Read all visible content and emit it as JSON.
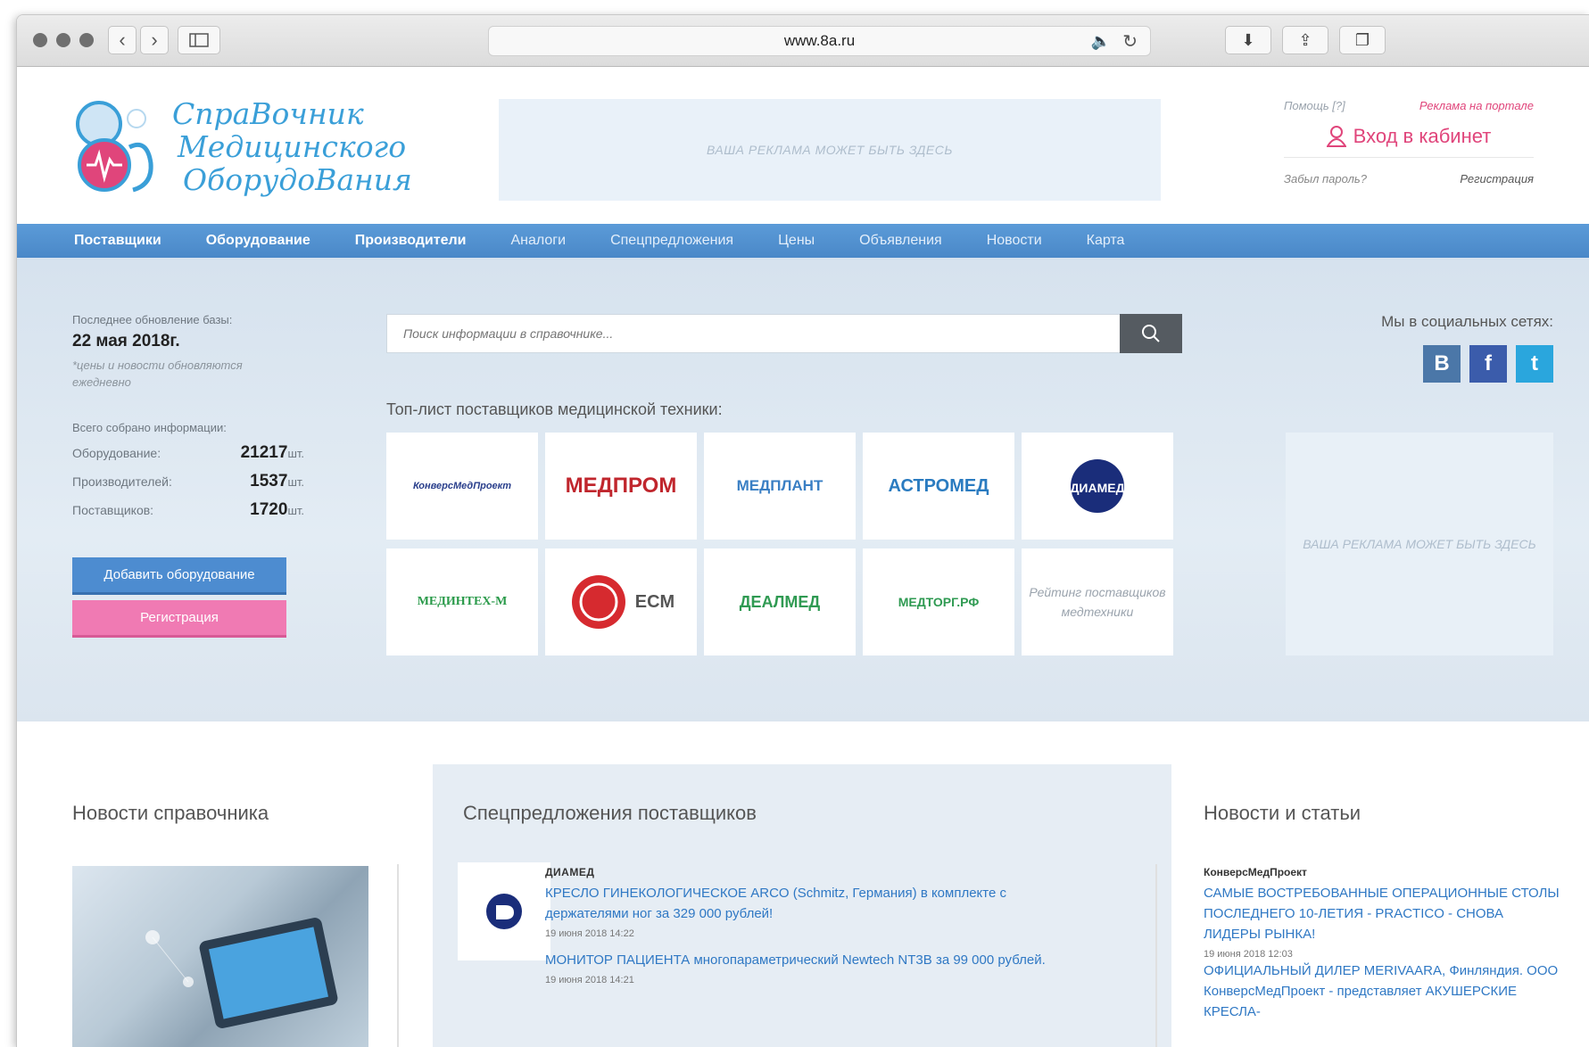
{
  "browser": {
    "url": "www.8a.ru"
  },
  "header": {
    "logo_lines": [
      "СпраВочник",
      "Медицинского",
      "ОборудоВания"
    ],
    "ad_text": "ВАША РЕКЛАМА МОЖЕТ БЫТЬ ЗДЕСЬ",
    "help": "Помощь [?]",
    "advertise": "Реклама на портале",
    "login": "Вход в кабинет",
    "forgot": "Забыл пароль?",
    "register": "Регистрация"
  },
  "nav": [
    "Поставщики",
    "Оборудование",
    "Производители",
    "Аналоги",
    "Спецпредложения",
    "Цены",
    "Объявления",
    "Новости",
    "Карта"
  ],
  "sidebar": {
    "update_label": "Последнее обновление базы:",
    "update_date": "22 мая 2018г.",
    "update_note": "*цены и новости обновляются ежедневно",
    "total_label": "Всего собрано информации:",
    "stats": [
      {
        "label": "Оборудование:",
        "value": "21217",
        "unit": "шт."
      },
      {
        "label": "Производителей:",
        "value": "1537",
        "unit": "шт."
      },
      {
        "label": "Поставщиков:",
        "value": "1720",
        "unit": "шт."
      }
    ],
    "add_button": "Добавить оборудование",
    "register_button": "Регистрация"
  },
  "search": {
    "placeholder": "Поиск информации в справочнике..."
  },
  "top_list": {
    "title": "Топ-лист поставщиков медицинской техники:",
    "suppliers": [
      {
        "name": "КонверсМедПроект",
        "color": "#2a3f8c"
      },
      {
        "name": "МЕДПРОМ",
        "color": "#c0262d"
      },
      {
        "name": "МЕДПЛАНТ",
        "color": "#3a7fc4"
      },
      {
        "name": "АСТРОМЕД",
        "color": "#2a7bc0"
      },
      {
        "name": "ДИАМЕД",
        "color": "#1a2d7a"
      },
      {
        "name": "МЕДИНТЕХ-М",
        "color": "#2a9a4a"
      },
      {
        "name": "ECM",
        "color": "#555555"
      },
      {
        "name": "ДЕАЛМЕД",
        "color": "#2f9a52"
      },
      {
        "name": "МЕДТОРГ.РФ",
        "color": "#2f9a52"
      }
    ],
    "rating_text": "Рейтинг поставщиков медтехники"
  },
  "social": {
    "title": "Мы в социальных сетях:",
    "icons": [
      {
        "name": "vk-icon",
        "glyph": "B",
        "color": "#4b77a8"
      },
      {
        "name": "facebook-icon",
        "glyph": "f",
        "color": "#3b5cab"
      },
      {
        "name": "twitter-icon",
        "glyph": "t",
        "color": "#2aa6dd"
      }
    ]
  },
  "right_ad": "ВАША РЕКЛАМА МОЖЕТ БЫТЬ ЗДЕСЬ",
  "lower": {
    "news_title": "Новости справочника",
    "offers_title": "Спецпредложения поставщиков",
    "articles_title": "Новости и статьи",
    "offers": [
      {
        "company": "ДИАМЕД",
        "text": "КРЕСЛО ГИНЕКОЛОГИЧЕСКОЕ ARCO (Schmitz, Германия) в комплекте с держателями ног за 329 000 рублей!",
        "time": "19 июня 2018 14:22"
      },
      {
        "company": "",
        "text": "МОНИТОР ПАЦИЕНТА многопараметрический Newtech NT3B за 99 000 рублей.",
        "time": "19 июня 2018 14:21"
      }
    ],
    "articles": [
      {
        "company": "КонверсМедПроект",
        "text": "САМЫЕ ВОСТРЕБОВАННЫЕ ОПЕРАЦИОННЫЕ СТОЛЫ ПОСЛЕДНЕГО 10-ЛЕТИЯ - PRACTICO - СНОВА ЛИДЕРЫ РЫНКА!",
        "time": "19 июня 2018 12:03"
      },
      {
        "company": "",
        "text": "ОФИЦИАЛЬНЫЙ ДИЛЕР MERIVAARA, Финляндия. ООО КонверсМедПроект - представляет АКУШЕРСКИЕ КРЕСЛА-",
        "time": ""
      }
    ]
  }
}
